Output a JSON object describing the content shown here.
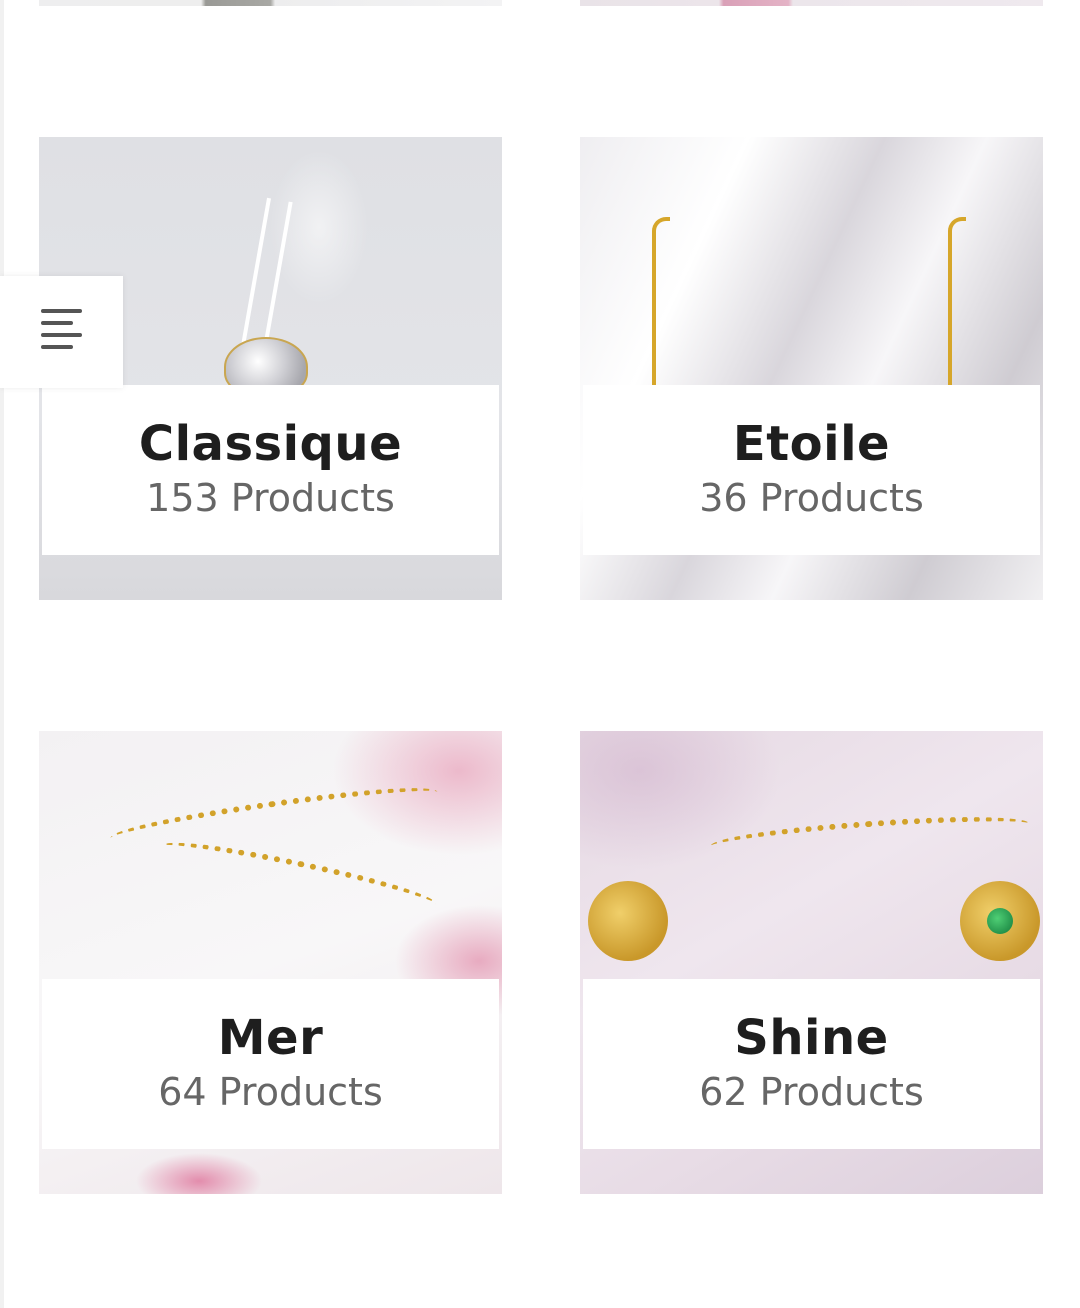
{
  "categories": [
    {
      "name": "Classique",
      "count": "153 Products"
    },
    {
      "name": "Etoile",
      "count": "36 Products"
    },
    {
      "name": "Mer",
      "count": "64 Products"
    },
    {
      "name": "Shine",
      "count": "62 Products"
    }
  ],
  "menu": {
    "icon": "hamburger-menu-icon"
  },
  "colors": {
    "title_text": "#1e1e1e",
    "count_text": "#666666",
    "label_background": "#ffffff",
    "gold_accent": "#d2a22a"
  }
}
